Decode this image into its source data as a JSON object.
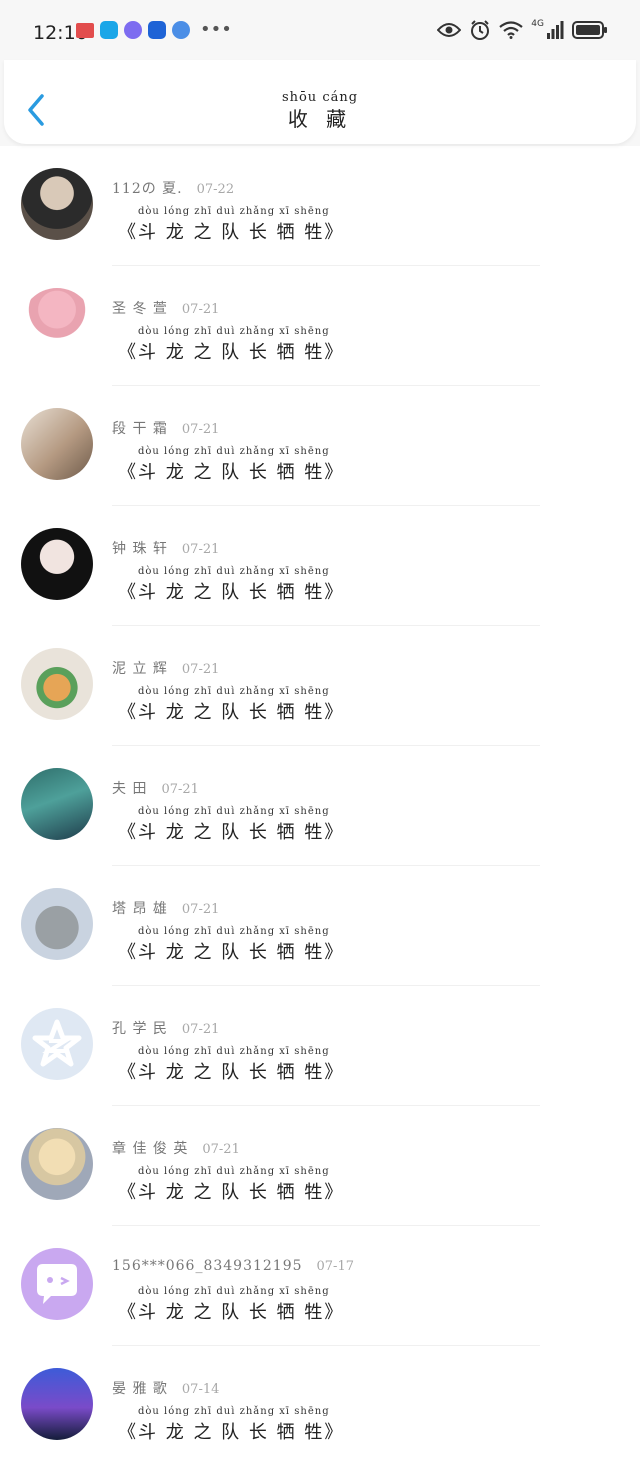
{
  "status_bar": {
    "time": "12:10",
    "network": "4G",
    "icons": [
      "book-app-icon",
      "search-app-icon",
      "music-app-icon",
      "bulb-app-icon",
      "globe-app-icon",
      "more-icon",
      "eye-icon",
      "alarm-icon",
      "wifi-icon",
      "signal-icon",
      "battery-icon"
    ]
  },
  "header": {
    "title_pinyin": "shōu cáng",
    "title": "收 藏",
    "back_icon": "chevron-left-icon",
    "accent_color": "#2a9be0"
  },
  "items": [
    {
      "name": "112の 夏.",
      "date": "07-22",
      "content_pinyin": "dòu lóng zhī duì zhǎng xī shēng",
      "content": "《斗 龙 之 队 长 牺 牲》"
    },
    {
      "name": "圣 冬 萱",
      "date": "07-21",
      "content_pinyin": "dòu lóng zhī duì zhǎng xī shēng",
      "content": "《斗 龙 之 队 长 牺 牲》"
    },
    {
      "name": "段 干 霜",
      "date": "07-21",
      "content_pinyin": "dòu lóng zhī duì zhǎng xī shēng",
      "content": "《斗 龙 之 队 长 牺 牲》"
    },
    {
      "name": "钟 珠 轩",
      "date": "07-21",
      "content_pinyin": "dòu lóng zhī duì zhǎng xī shēng",
      "content": "《斗 龙 之 队 长 牺 牲》"
    },
    {
      "name": "泥 立 辉",
      "date": "07-21",
      "content_pinyin": "dòu lóng zhī duì zhǎng xī shēng",
      "content": "《斗 龙 之 队 长 牺 牲》"
    },
    {
      "name": "夫 田",
      "date": "07-21",
      "content_pinyin": "dòu lóng zhī duì zhǎng xī shēng",
      "content": "《斗 龙 之 队 长 牺 牲》"
    },
    {
      "name": "塔 昂 雄",
      "date": "07-21",
      "content_pinyin": "dòu lóng zhī duì zhǎng xī shēng",
      "content": "《斗 龙 之 队 长 牺 牲》"
    },
    {
      "name": "孔 学 民",
      "date": "07-21",
      "content_pinyin": "dòu lóng zhī duì zhǎng xī shēng",
      "content": "《斗 龙 之 队 长 牺 牲》"
    },
    {
      "name": "章 佳 俊 英",
      "date": "07-21",
      "content_pinyin": "dòu lóng zhī duì zhǎng xī shēng",
      "content": "《斗 龙 之 队 长 牺 牲》"
    },
    {
      "name": "156***066_8349312195",
      "date": "07-17",
      "content_pinyin": "dòu lóng zhī duì zhǎng xī shēng",
      "content": "《斗 龙 之 队 长 牺 牲》"
    },
    {
      "name": "晏 雅 歌",
      "date": "07-14",
      "content_pinyin": "dòu lóng zhī duì zhǎng xī shēng",
      "content": "《斗 龙 之 队 长 牺 牲》"
    }
  ]
}
